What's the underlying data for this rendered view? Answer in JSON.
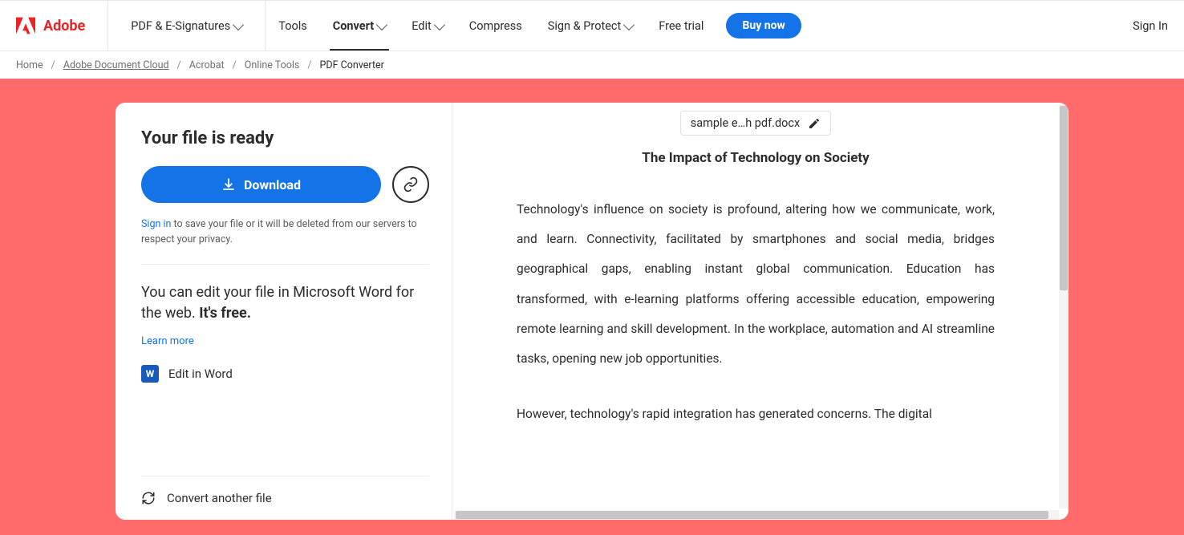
{
  "brand": {
    "name": "Adobe"
  },
  "nav": {
    "pdf_sign": "PDF & E-Signatures",
    "tools": "Tools",
    "convert": "Convert",
    "edit": "Edit",
    "compress": "Compress",
    "sign_protect": "Sign & Protect",
    "free_trial": "Free trial",
    "buy_now": "Buy now",
    "sign_in": "Sign In"
  },
  "breadcrumbs": {
    "home": "Home",
    "doc_cloud": "Adobe Document Cloud",
    "acrobat": "Acrobat",
    "online_tools": "Online Tools",
    "current": "PDF Converter"
  },
  "left": {
    "ready": "Your file is ready",
    "download": "Download",
    "signin_link": "Sign in",
    "signin_rest": " to save your file or it will be deleted from our servers to respect your privacy.",
    "edit_line1": "You can edit your file in Microsoft Word for the web. ",
    "edit_free": "It's free.",
    "learn_more": "Learn more",
    "edit_word": "Edit in Word",
    "convert_another": "Convert another file"
  },
  "preview": {
    "filename": "sample e…h pdf.docx",
    "doc_title": "The Impact of Technology on Society",
    "para1": "Technology's influence on society is profound, altering how we communicate, work, and learn. Connectivity, facilitated by smartphones and social media, bridges geographical gaps, enabling instant global communication. Education has transformed, with e-learning platforms offering accessible education, empowering remote learning and skill development. In the workplace, automation and AI streamline tasks, opening new job opportunities.",
    "para2": "However, technology's rapid integration has generated concerns. The digital"
  }
}
